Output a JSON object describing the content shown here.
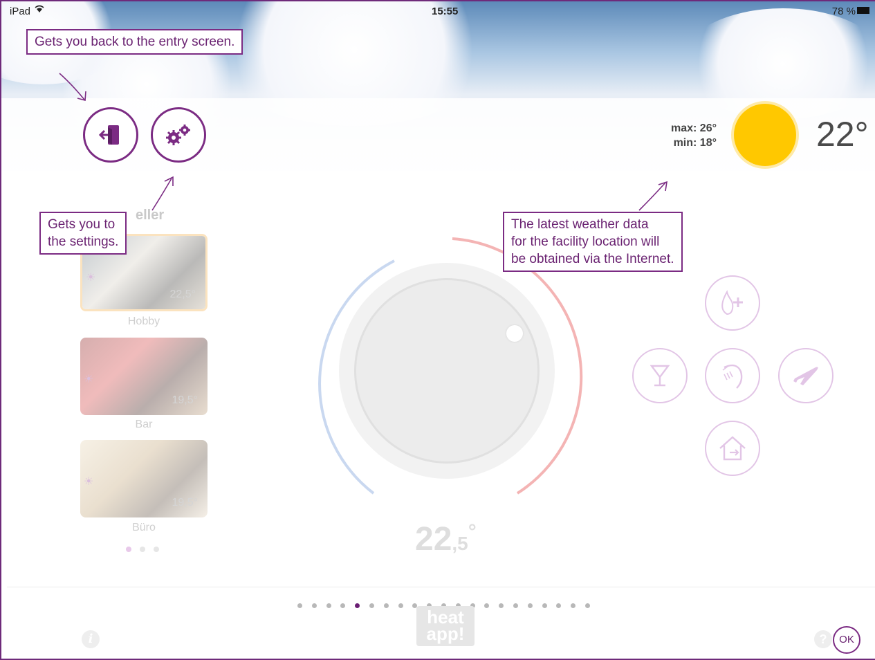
{
  "status_bar": {
    "device": "iPad",
    "time": "15:55",
    "battery": "78 %"
  },
  "header": {
    "exit_icon": "exit-door-icon",
    "settings_icon": "gears-icon",
    "weather": {
      "max": "max: 26°",
      "min": "min: 18°",
      "icon": "sun-icon",
      "current_temp": "22°"
    }
  },
  "callouts": {
    "entry": "Gets you back to the entry screen.",
    "settings": [
      "Gets you to",
      "the settings."
    ],
    "weather": [
      "The latest weather data",
      "for the facility location will",
      "be obtained via the Internet."
    ]
  },
  "rooms": {
    "group_title": "eller",
    "items": [
      {
        "label": "Hobby",
        "temp": "22,5°"
      },
      {
        "label": "Bar",
        "temp": "19,5°"
      },
      {
        "label": "Büro",
        "temp": "19,5°"
      }
    ]
  },
  "dial": {
    "setpoint_main": "22",
    "setpoint_decimal": ",5",
    "setpoint_degree": "°"
  },
  "modes": [
    "boost-flame-icon",
    "party-cocktail-icon",
    "shower-icon",
    "vacation-plane-icon",
    "leave-home-icon"
  ],
  "footer": {
    "logo_top": "heat",
    "logo_bottom": "app!",
    "info_label": "i",
    "help_label": "?",
    "ok_label": "OK"
  },
  "colors": {
    "accent": "#7b2b83",
    "sun": "#ffc800"
  }
}
